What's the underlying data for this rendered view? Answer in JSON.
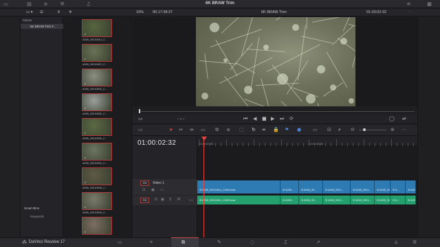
{
  "app": {
    "name": "DaVinci Resolve 17",
    "project_title": "6K BRAW Trim"
  },
  "topbar": {
    "icons": [
      "media-pool-icon",
      "effects-icon",
      "edit-index-icon",
      "sound-library-icon",
      "inspector-icon",
      "metadata-icon",
      "mixer-icon"
    ]
  },
  "subbar": {
    "left_count": "6",
    "zoom": "19%",
    "source_timecode": "00:17:38:37",
    "timeline_name": "6K BRAW Trim",
    "record_timecode": "01:00:02:32"
  },
  "bins": {
    "master_label": "Master",
    "bin_label": "6K BRAW Trim F...",
    "smart_bins_label": "Smart Bins",
    "keywords_label": "Keywords"
  },
  "thumbnails": [
    {
      "label": "A055_09210814_C..."
    },
    {
      "label": "A055_09210822_C..."
    },
    {
      "label": "A055_09210830_C..."
    },
    {
      "label": "A055_09210830_C..."
    },
    {
      "label": "A055_09210830_C..."
    },
    {
      "label": "A055_09210834_C..."
    },
    {
      "label": "A055_09210838_C..."
    },
    {
      "label": "A055_09210845_C..."
    },
    {
      "label": ""
    }
  ],
  "timeline": {
    "current_timecode": "01:00:02:32",
    "ruler_labels": [
      "01:00:00:00",
      "01:00:38:00"
    ],
    "video_track": {
      "tag": "V1",
      "name": "Video 1"
    },
    "audio_track": {
      "tag": "A1",
      "level": "2.0"
    },
    "video_clips": [
      "A055_09210814_C005.braw",
      "A055...",
      "A055_09...",
      "A055_0921...",
      "A055_0921...",
      "A055_09...",
      "A...",
      "A055..."
    ],
    "audio_clips": [
      "A055_09210814_C005.braw",
      "A055...",
      "A055_09...",
      "A055_0921...",
      "A055_0921...",
      "A055_09...",
      "A...",
      "A055..."
    ]
  },
  "pages": [
    "media",
    "cut",
    "edit",
    "fusion",
    "color",
    "fairlight",
    "deliver"
  ],
  "colors": {
    "accent": "#e0443e",
    "video_clip": "#2e7bb3",
    "audio_clip": "#23a06e"
  }
}
